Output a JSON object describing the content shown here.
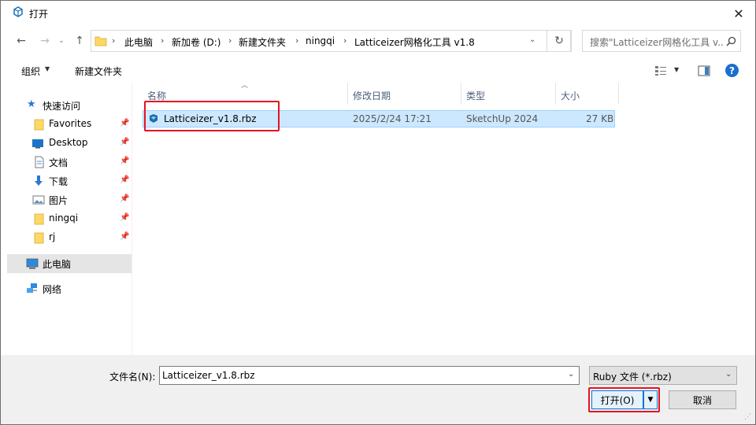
{
  "window": {
    "title": "打开"
  },
  "address": {
    "crumbs": [
      "此电脑",
      "新加卷 (D:)",
      "新建文件夹",
      "ningqi",
      "Latticeizer网格化工具 v1.8"
    ],
    "search_placeholder": "搜索\"Latticeizer网格化工具 v..."
  },
  "toolbar": {
    "organize": "组织",
    "new_folder": "新建文件夹"
  },
  "sidebar": {
    "items": [
      {
        "label": "快速访问"
      },
      {
        "label": "Favorites"
      },
      {
        "label": "Desktop"
      },
      {
        "label": "文档"
      },
      {
        "label": "下载"
      },
      {
        "label": "图片"
      },
      {
        "label": "ningqi"
      },
      {
        "label": "rj"
      },
      {
        "label": "此电脑"
      },
      {
        "label": "网络"
      }
    ]
  },
  "columns": {
    "name": "名称",
    "date": "修改日期",
    "type": "类型",
    "size": "大小"
  },
  "files": [
    {
      "name": "Latticeizer_v1.8.rbz",
      "date": "2025/2/24 17:21",
      "type": "SketchUp 2024",
      "size": "27 KB"
    }
  ],
  "bottom": {
    "filename_label": "文件名(N):",
    "filename_value": "Latticeizer_v1.8.rbz",
    "filetype": "Ruby 文件 (*.rbz)",
    "open_label": "打开(O)",
    "cancel_label": "取消"
  },
  "colors": {
    "accent": "#0078d7",
    "highlight": "#e81123",
    "selection": "#cce8ff",
    "folder": "#ffd866"
  }
}
